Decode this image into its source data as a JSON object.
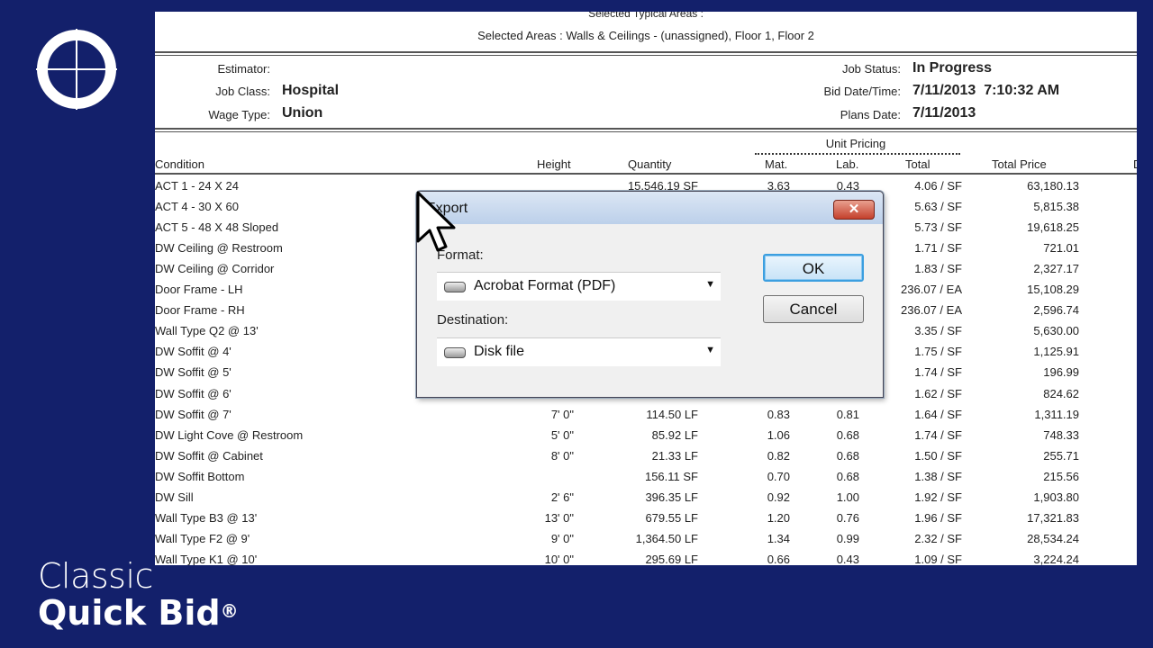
{
  "brand": {
    "line1": "Classic",
    "line2": "Quick Bid",
    "reg": "®"
  },
  "report": {
    "typical_areas": "Selected Typical Areas :",
    "selected_areas": "Selected Areas : Walls & Ceilings -  (unassigned), Floor 1, Floor 2",
    "estimator_label": "Estimator:",
    "estimator_value": "",
    "job_class_label": "Job Class:",
    "job_class_value": "Hospital",
    "wage_type_label": "Wage Type:",
    "wage_type_value": "Union",
    "job_status_label": "Job Status:",
    "job_status_value": "In Progress",
    "bid_date_label": "Bid Date/Time:",
    "bid_date_value": "7/11/2013  7:10:32 AM",
    "plans_date_label": "Plans Date:",
    "plans_date_value": "7/11/2013",
    "unit_pricing": "Unit Pricing",
    "columns": {
      "condition": "Condition",
      "height": "Height",
      "quantity": "Quantity",
      "mat": "Mat.",
      "lab": "Lab.",
      "total": "Total",
      "total_price": "Total Price",
      "extra": "D"
    },
    "rows": [
      {
        "condition": "ACT 1 - 24 X 24",
        "height": "",
        "quantity": "15,546.19 SF",
        "mat": "3.63",
        "lab": "0.43",
        "total": "4.06 / SF",
        "total_price": "63,180.13"
      },
      {
        "condition": "ACT 4 - 30 X 60",
        "height": "",
        "quantity": "",
        "mat": "",
        "lab": "",
        "total": "5.63 / SF",
        "total_price": "5,815.38"
      },
      {
        "condition": "ACT 5 - 48 X 48 Sloped",
        "height": "",
        "quantity": "",
        "mat": "",
        "lab": "",
        "total": "5.73 / SF",
        "total_price": "19,618.25"
      },
      {
        "condition": "DW Ceiling @ Restroom",
        "height": "",
        "quantity": "",
        "mat": "",
        "lab": "",
        "total": "1.71 / SF",
        "total_price": "721.01"
      },
      {
        "condition": "DW Ceiling @ Corridor",
        "height": "",
        "quantity": "",
        "mat": "",
        "lab": "",
        "total": "1.83 / SF",
        "total_price": "2,327.17"
      },
      {
        "condition": "Door Frame - LH",
        "height": "",
        "quantity": "",
        "mat": "",
        "lab": "",
        "total": "236.07 / EA",
        "total_price": "15,108.29"
      },
      {
        "condition": "Door Frame - RH",
        "height": "",
        "quantity": "",
        "mat": "",
        "lab": "",
        "total": "236.07 / EA",
        "total_price": "2,596.74"
      },
      {
        "condition": "Wall Type Q2 @ 13'",
        "height": "",
        "quantity": "",
        "mat": "",
        "lab": "",
        "total": "3.35 / SF",
        "total_price": "5,630.00"
      },
      {
        "condition": "DW Soffit @ 4'",
        "height": "",
        "quantity": "",
        "mat": "",
        "lab": "",
        "total": "1.75 / SF",
        "total_price": "1,125.91"
      },
      {
        "condition": "DW Soffit @ 5'",
        "height": "",
        "quantity": "",
        "mat": "",
        "lab": "",
        "total": "1.74 / SF",
        "total_price": "196.99"
      },
      {
        "condition": "DW Soffit @ 6'",
        "height": "",
        "quantity": "",
        "mat": "",
        "lab": "",
        "total": "1.62 / SF",
        "total_price": "824.62"
      },
      {
        "condition": "DW Soffit @ 7'",
        "height": "7' 0\"",
        "quantity": "114.50 LF",
        "mat": "0.83",
        "lab": "0.81",
        "total": "1.64 / SF",
        "total_price": "1,311.19"
      },
      {
        "condition": "DW Light Cove @ Restroom",
        "height": "5' 0\"",
        "quantity": "85.92 LF",
        "mat": "1.06",
        "lab": "0.68",
        "total": "1.74 / SF",
        "total_price": "748.33"
      },
      {
        "condition": "DW Soffit @ Cabinet",
        "height": "8' 0\"",
        "quantity": "21.33 LF",
        "mat": "0.82",
        "lab": "0.68",
        "total": "1.50 / SF",
        "total_price": "255.71"
      },
      {
        "condition": "DW Soffit Bottom",
        "height": "",
        "quantity": "156.11 SF",
        "mat": "0.70",
        "lab": "0.68",
        "total": "1.38 / SF",
        "total_price": "215.56"
      },
      {
        "condition": "DW Sill",
        "height": "2' 6\"",
        "quantity": "396.35 LF",
        "mat": "0.92",
        "lab": "1.00",
        "total": "1.92 / SF",
        "total_price": "1,903.80"
      },
      {
        "condition": "Wall Type B3 @ 13'",
        "height": "13' 0\"",
        "quantity": "679.55 LF",
        "mat": "1.20",
        "lab": "0.76",
        "total": "1.96 / SF",
        "total_price": "17,321.83"
      },
      {
        "condition": "Wall Type F2 @ 9'",
        "height": "9' 0\"",
        "quantity": "1,364.50 LF",
        "mat": "1.34",
        "lab": "0.99",
        "total": "2.32 / SF",
        "total_price": "28,534.24"
      },
      {
        "condition": "Wall Type K1 @ 10'",
        "height": "10' 0\"",
        "quantity": "295.69 LF",
        "mat": "0.66",
        "lab": "0.43",
        "total": "1.09 / SF",
        "total_price": "3,224.24"
      }
    ]
  },
  "dialog": {
    "title": "Export",
    "close": "✕",
    "format_label": "Format:",
    "format_value": "Acrobat Format (PDF)",
    "destination_label": "Destination:",
    "destination_value": "Disk file",
    "ok": "OK",
    "cancel": "Cancel"
  },
  "colors": {
    "background": "#13206b",
    "dialog_focus": "#3c9fe0",
    "close_button": "#c4402c"
  }
}
